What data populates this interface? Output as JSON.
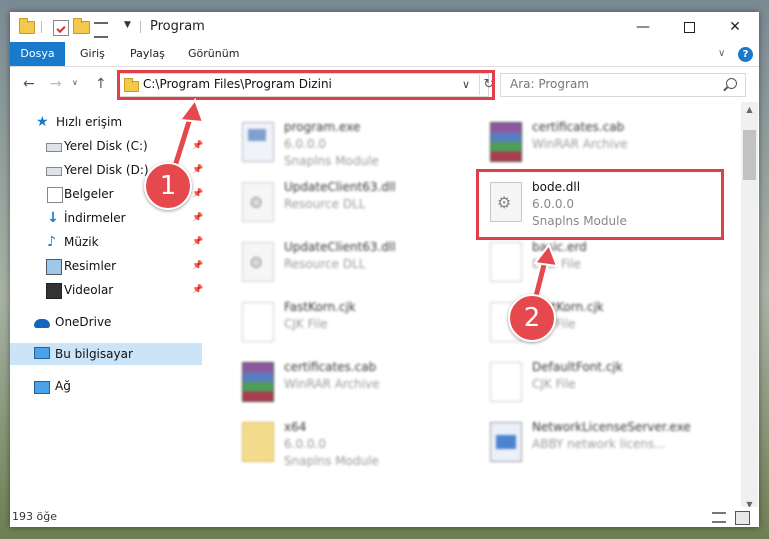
{
  "window": {
    "title": "Program"
  },
  "ribbon": {
    "file": "Dosya",
    "home": "Giriş",
    "share": "Paylaş",
    "view": "Görünüm",
    "help": "?"
  },
  "address": {
    "path": "C:\\Program Files\\Program Dizini",
    "search_placeholder": "Ara: Program"
  },
  "sidebar": {
    "quick_access": "Hızlı erişim",
    "items": [
      {
        "label": "Yerel Disk (C:)",
        "icon": "drive-icon"
      },
      {
        "label": "Yerel Disk (D:)",
        "icon": "drive-icon"
      },
      {
        "label": "Belgeler",
        "icon": "documents-icon"
      },
      {
        "label": "İndirmeler",
        "icon": "download-icon"
      },
      {
        "label": "Müzik",
        "icon": "music-icon"
      },
      {
        "label": "Resimler",
        "icon": "pictures-icon"
      },
      {
        "label": "Videolar",
        "icon": "video-icon"
      }
    ],
    "onedrive": "OneDrive",
    "this_pc": "Bu bilgisayar",
    "network": "Ağ"
  },
  "files": [
    {
      "name": "program.exe",
      "line1": "6.0.0.0",
      "line2": "Snaplns Module",
      "icon": "exe-icon",
      "blurred": true
    },
    {
      "name": "certificates.cab",
      "line1": "WinRAR Archive",
      "line2": "",
      "icon": "rar-icon",
      "blurred": true
    },
    {
      "name": "UpdateClient63.dll",
      "line1": "Resource DLL",
      "line2": "",
      "icon": "dll-icon",
      "blurred": true
    },
    {
      "name": "bode.dll",
      "line1": "6.0.0.0",
      "line2": "Snaplns Module",
      "icon": "dll-icon",
      "blurred": false
    },
    {
      "name": "UpdateClient63.dll",
      "line1": "Resource DLL",
      "line2": "",
      "icon": "dll-icon",
      "blurred": true
    },
    {
      "name": "basic.erd",
      "line1": "ERD File",
      "line2": "",
      "icon": "document-icon",
      "blurred": true
    },
    {
      "name": "FastKorn.cjk",
      "line1": "CJK File",
      "line2": "",
      "icon": "document-icon",
      "blurred": true
    },
    {
      "name": "FastKorn.cjk",
      "line1": "CJK File",
      "line2": "",
      "icon": "document-icon",
      "blurred": true
    },
    {
      "name": "certificates.cab",
      "line1": "WinRAR Archive",
      "line2": "",
      "icon": "rar-icon",
      "blurred": true
    },
    {
      "name": "DefaultFont.cjk",
      "line1": "CJK File",
      "line2": "",
      "icon": "document-icon",
      "blurred": true
    },
    {
      "name": "x64",
      "line1": "6.0.0.0",
      "line2": "Snaplns Module",
      "icon": "folder-icon",
      "blurred": true
    },
    {
      "name": "NetworkLicenseServer.exe",
      "line1": "ABBY network licens...",
      "line2": "",
      "icon": "network-exe-icon",
      "blurred": true
    }
  ],
  "status": {
    "item_count": "193 öğe"
  },
  "callouts": [
    {
      "number": "1"
    },
    {
      "number": "2"
    }
  ],
  "colors": {
    "accent": "#1979ca",
    "callout": "#e5484d",
    "selection": "#cce4f7"
  }
}
